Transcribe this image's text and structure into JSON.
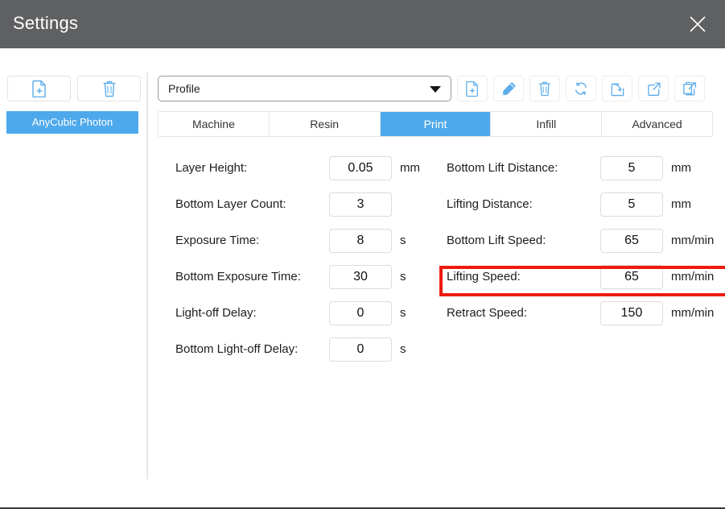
{
  "window": {
    "title": "Settings",
    "close_icon": "close-icon"
  },
  "colors": {
    "titlebar": "#5f6062",
    "accent": "#4ea9ec",
    "icon_blue": "#5cacea",
    "highlight_red": "#ee1b11"
  },
  "sidebar": {
    "tools": [
      {
        "name": "new-profile-button",
        "icon": "new-file-icon"
      },
      {
        "name": "delete-profile-button",
        "icon": "trash-icon"
      }
    ],
    "profiles": [
      {
        "label": "AnyCubic Photon",
        "selected": true
      }
    ]
  },
  "toolbar": {
    "profile_select": {
      "value": "Profile",
      "placeholder": "Profile",
      "arrow_icon": "chevron-down-icon"
    },
    "buttons": [
      {
        "name": "new-button",
        "icon": "new-file-icon"
      },
      {
        "name": "edit-button",
        "icon": "pencil-icon"
      },
      {
        "name": "delete-button",
        "icon": "trash-icon"
      },
      {
        "name": "reset-button",
        "icon": "refresh-icon"
      },
      {
        "name": "import-button",
        "icon": "import-arrow-icon"
      },
      {
        "name": "export-button",
        "icon": "export-arrow-icon"
      },
      {
        "name": "export-all-button",
        "icon": "export-all-icon"
      }
    ]
  },
  "tabs": [
    {
      "label": "Machine",
      "active": false
    },
    {
      "label": "Resin",
      "active": false
    },
    {
      "label": "Print",
      "active": true
    },
    {
      "label": "Infill",
      "active": false
    },
    {
      "label": "Advanced",
      "active": false
    }
  ],
  "form": {
    "left_column": [
      {
        "label": "Layer Height:",
        "value": "0.05",
        "unit": "mm"
      },
      {
        "label": "Bottom Layer Count:",
        "value": "3",
        "unit": ""
      },
      {
        "label": "Exposure Time:",
        "value": "8",
        "unit": "s"
      },
      {
        "label": "Bottom Exposure Time:",
        "value": "30",
        "unit": "s"
      },
      {
        "label": "Light-off Delay:",
        "value": "0",
        "unit": "s"
      },
      {
        "label": "Bottom Light-off Delay:",
        "value": "0",
        "unit": "s"
      }
    ],
    "right_column": [
      {
        "label": "Bottom Lift Distance:",
        "value": "5",
        "unit": "mm"
      },
      {
        "label": "Lifting Distance:",
        "value": "5",
        "unit": "mm"
      },
      {
        "label": "Bottom Lift Speed:",
        "value": "65",
        "unit": "mm/min"
      },
      {
        "label": "Lifting Speed:",
        "value": "65",
        "unit": "mm/min"
      },
      {
        "label": "Retract Speed:",
        "value": "150",
        "unit": "mm/min"
      }
    ]
  },
  "annotation": {
    "highlighted_field": "Lifting Speed:"
  }
}
